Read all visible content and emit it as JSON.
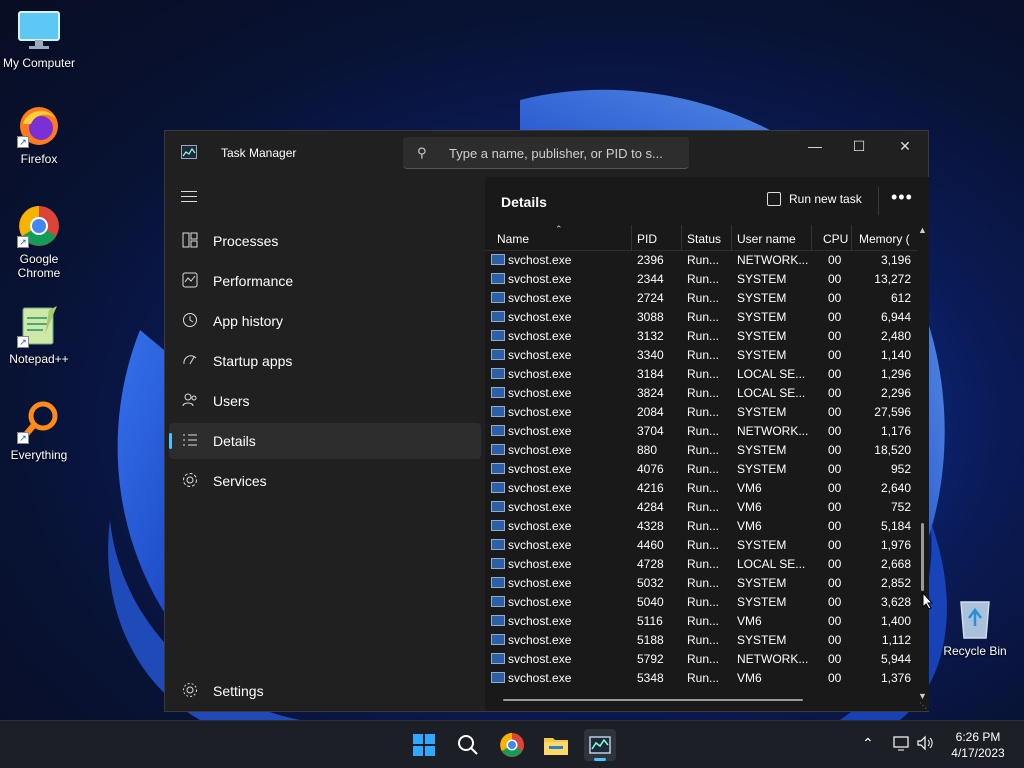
{
  "desktop": {
    "icons": [
      {
        "label": "My Computer"
      },
      {
        "label": "Firefox"
      },
      {
        "label": "Google Chrome"
      },
      {
        "label": "Notepad++"
      },
      {
        "label": "Everything"
      },
      {
        "label": "Recycle Bin"
      }
    ]
  },
  "window": {
    "title": "Task Manager",
    "search_placeholder": "Type a name, publisher, or PID to s...",
    "controls": {
      "minimize": "—",
      "maximize": "☐",
      "close": "✕"
    }
  },
  "sidebar": {
    "items": [
      {
        "label": "Processes",
        "icon": "processes-icon"
      },
      {
        "label": "Performance",
        "icon": "performance-icon"
      },
      {
        "label": "App history",
        "icon": "history-icon"
      },
      {
        "label": "Startup apps",
        "icon": "startup-icon"
      },
      {
        "label": "Users",
        "icon": "users-icon"
      },
      {
        "label": "Details",
        "icon": "list-icon",
        "active": true
      },
      {
        "label": "Services",
        "icon": "services-icon"
      }
    ],
    "settings_label": "Settings"
  },
  "details": {
    "title": "Details",
    "run_new_task": "Run new task",
    "more": "•••",
    "columns": [
      "Name",
      "PID",
      "Status",
      "User name",
      "CPU",
      "Memory ("
    ],
    "rows": [
      [
        "svchost.exe",
        "2396",
        "Run...",
        "NETWORK...",
        "00",
        "3,196"
      ],
      [
        "svchost.exe",
        "2344",
        "Run...",
        "SYSTEM",
        "00",
        "13,272"
      ],
      [
        "svchost.exe",
        "2724",
        "Run...",
        "SYSTEM",
        "00",
        "612"
      ],
      [
        "svchost.exe",
        "3088",
        "Run...",
        "SYSTEM",
        "00",
        "6,944"
      ],
      [
        "svchost.exe",
        "3132",
        "Run...",
        "SYSTEM",
        "00",
        "2,480"
      ],
      [
        "svchost.exe",
        "3340",
        "Run...",
        "SYSTEM",
        "00",
        "1,140"
      ],
      [
        "svchost.exe",
        "3184",
        "Run...",
        "LOCAL SE...",
        "00",
        "1,296"
      ],
      [
        "svchost.exe",
        "3824",
        "Run...",
        "LOCAL SE...",
        "00",
        "2,296"
      ],
      [
        "svchost.exe",
        "2084",
        "Run...",
        "SYSTEM",
        "00",
        "27,596"
      ],
      [
        "svchost.exe",
        "3704",
        "Run...",
        "NETWORK...",
        "00",
        "1,176"
      ],
      [
        "svchost.exe",
        "880",
        "Run...",
        "SYSTEM",
        "00",
        "18,520"
      ],
      [
        "svchost.exe",
        "4076",
        "Run...",
        "SYSTEM",
        "00",
        "952"
      ],
      [
        "svchost.exe",
        "4216",
        "Run...",
        "VM6",
        "00",
        "2,640"
      ],
      [
        "svchost.exe",
        "4284",
        "Run...",
        "VM6",
        "00",
        "752"
      ],
      [
        "svchost.exe",
        "4328",
        "Run...",
        "VM6",
        "00",
        "5,184"
      ],
      [
        "svchost.exe",
        "4460",
        "Run...",
        "SYSTEM",
        "00",
        "1,976"
      ],
      [
        "svchost.exe",
        "4728",
        "Run...",
        "LOCAL SE...",
        "00",
        "2,668"
      ],
      [
        "svchost.exe",
        "5032",
        "Run...",
        "SYSTEM",
        "00",
        "2,852"
      ],
      [
        "svchost.exe",
        "5040",
        "Run...",
        "SYSTEM",
        "00",
        "3,628"
      ],
      [
        "svchost.exe",
        "5116",
        "Run...",
        "VM6",
        "00",
        "1,400"
      ],
      [
        "svchost.exe",
        "5188",
        "Run...",
        "SYSTEM",
        "00",
        "1,112"
      ],
      [
        "svchost.exe",
        "5792",
        "Run...",
        "NETWORK...",
        "00",
        "5,944"
      ],
      [
        "svchost.exe",
        "5348",
        "Run...",
        "VM6",
        "00",
        "1,376"
      ]
    ]
  },
  "taskbar": {
    "time": "6:26 PM",
    "date": "4/17/2023"
  },
  "colors": {
    "accent": "#4cc2ff",
    "window_bg": "#202020",
    "panel_bg": "#191919"
  }
}
